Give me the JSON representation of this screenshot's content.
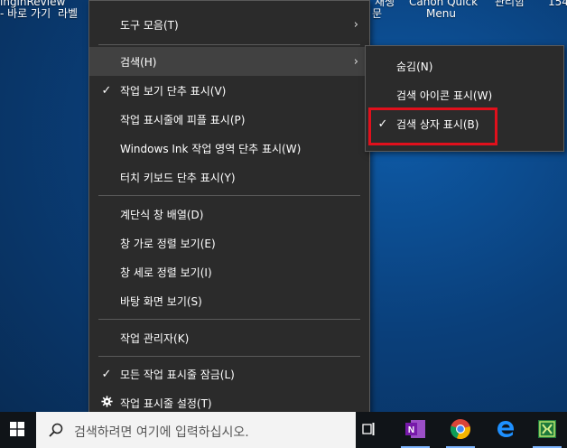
{
  "desktop": {
    "labels": [
      "inginReview",
      "- 바로 가기",
      "라벨",
      "재생",
      "Canon Quick",
      "Menu",
      "문",
      "관리함",
      "154"
    ]
  },
  "context_menu": {
    "items": [
      {
        "label": "도구 모음(T)",
        "checked": false,
        "submenu": true
      },
      {
        "label": "검색(H)",
        "checked": false,
        "submenu": true,
        "hover": true
      },
      {
        "label": "작업 보기 단추 표시(V)",
        "checked": true
      },
      {
        "label": "작업 표시줄에 피플 표시(P)",
        "checked": false
      },
      {
        "label": "Windows Ink 작업 영역 단추 표시(W)",
        "checked": false
      },
      {
        "label": "터치 키보드 단추 표시(Y)",
        "checked": false
      },
      {
        "label": "계단식 창 배열(D)",
        "checked": false
      },
      {
        "label": "창 가로 정렬 보기(E)",
        "checked": false
      },
      {
        "label": "창 세로 정렬 보기(I)",
        "checked": false
      },
      {
        "label": "바탕 화면 보기(S)",
        "checked": false
      },
      {
        "label": "작업 관리자(K)",
        "checked": false
      },
      {
        "label": "모든 작업 표시줄 잠금(L)",
        "checked": true
      },
      {
        "label": "작업 표시줄 설정(T)",
        "checked": false,
        "icon": "gear-icon"
      }
    ]
  },
  "search_submenu": {
    "items": [
      {
        "label": "숨김(N)",
        "checked": false
      },
      {
        "label": "검색 아이콘 표시(W)",
        "checked": false
      },
      {
        "label": "검색 상자 표시(B)",
        "checked": true
      }
    ]
  },
  "symbols": {
    "check": "✓",
    "arrow": "›"
  },
  "taskbar": {
    "search_placeholder": "검색하려면 여기에 입력하십시오.",
    "pinned": [
      "task-view-icon",
      "onenote-icon",
      "chrome-icon",
      "edge-icon",
      "excel-icon"
    ]
  },
  "colors": {
    "menu_bg": "#2b2b2b",
    "menu_hover": "#414141",
    "highlight": "#e0101c",
    "taskbar_bg": "#101418"
  }
}
